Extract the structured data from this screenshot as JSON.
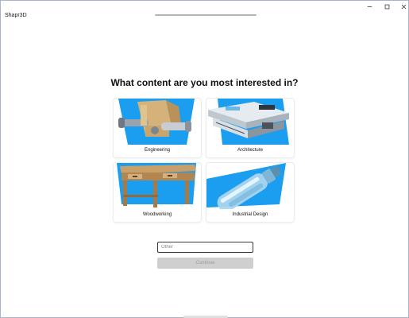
{
  "window": {
    "title": "Shapr3D",
    "progress": 1.0,
    "controls": [
      "minimize-icon",
      "maximize-icon",
      "close-icon"
    ]
  },
  "main": {
    "question": "What content are you most interested in?",
    "cards": [
      {
        "label": "Engineering",
        "icon": "engineering-part-image"
      },
      {
        "label": "Architecture",
        "icon": "architecture-building-image"
      },
      {
        "label": "Woodworking",
        "icon": "woodworking-table-image"
      },
      {
        "label": "Industrial Design",
        "icon": "industrial-design-bottle-image"
      }
    ],
    "other_placeholder": "Other",
    "other_value": "",
    "continue_label": "Continue"
  },
  "colors": {
    "accent_blue": "#1b9df0",
    "button_disabled": "#cfcfcf",
    "button_disabled_text": "#9b9b9b"
  }
}
